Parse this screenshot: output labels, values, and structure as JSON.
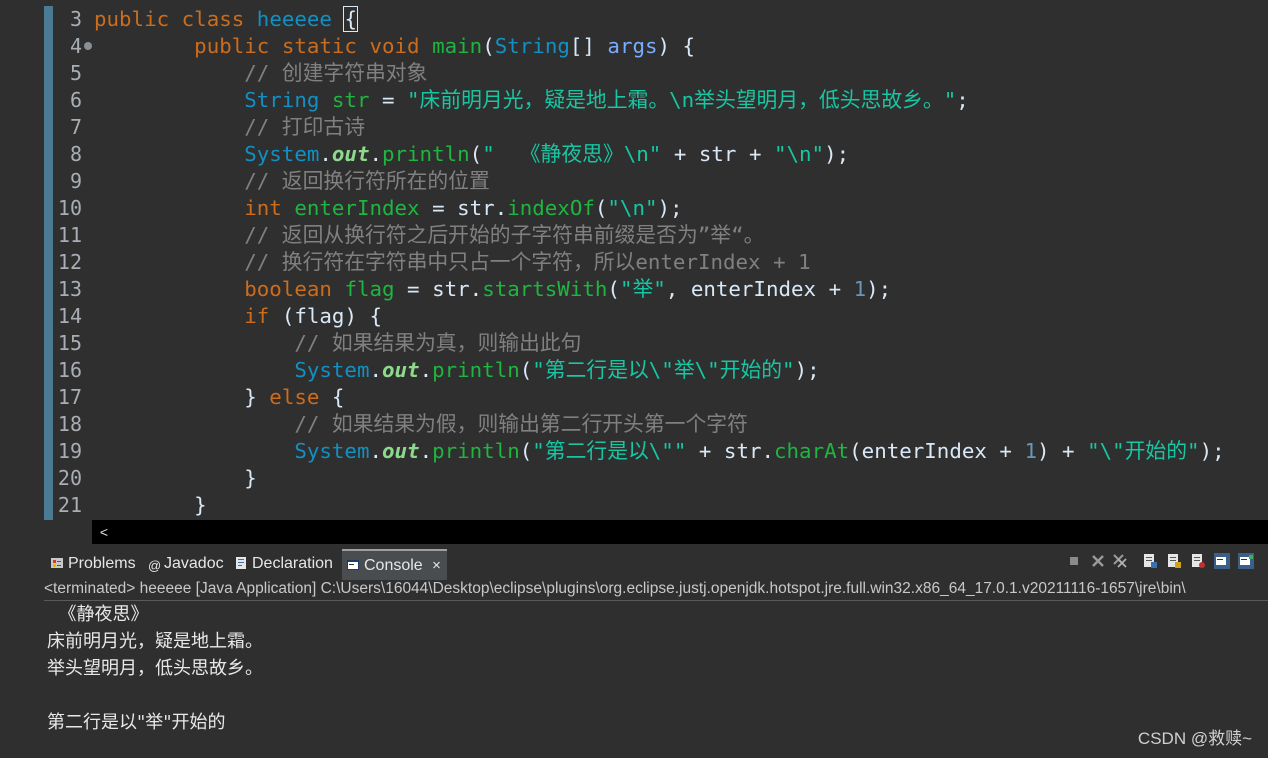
{
  "editor": {
    "line_numbers": [
      "3",
      "4",
      "5",
      "6",
      "7",
      "8",
      "9",
      "10",
      "11",
      "12",
      "13",
      "14",
      "15",
      "16",
      "17",
      "18",
      "19",
      "20",
      "21"
    ],
    "lines": [
      [
        [
          "kw",
          "public"
        ],
        [
          "pl",
          " "
        ],
        [
          "kw",
          "class"
        ],
        [
          "pl",
          " "
        ],
        [
          "ty",
          "heeeee"
        ],
        [
          "pl",
          " "
        ],
        [
          "brace",
          "{"
        ]
      ],
      [
        [
          "pl",
          "        "
        ],
        [
          "kw",
          "public"
        ],
        [
          "pl",
          " "
        ],
        [
          "kw",
          "static"
        ],
        [
          "pl",
          " "
        ],
        [
          "kw",
          "void"
        ],
        [
          "pl",
          " "
        ],
        [
          "df",
          "main"
        ],
        [
          "pl",
          "("
        ],
        [
          "ty",
          "String"
        ],
        [
          "pl",
          "[] "
        ],
        [
          "pm",
          "args"
        ],
        [
          "pl",
          ") {"
        ]
      ],
      [
        [
          "pl",
          "            "
        ],
        [
          "cm",
          "// 创建字符串对象"
        ]
      ],
      [
        [
          "pl",
          "            "
        ],
        [
          "ty",
          "String"
        ],
        [
          "pl",
          " "
        ],
        [
          "df",
          "str"
        ],
        [
          "pl",
          " = "
        ],
        [
          "st",
          "\"床前明月光，疑是地上霜。\\n举头望明月，低头思故乡。\""
        ],
        [
          "pl",
          ";"
        ]
      ],
      [
        [
          "pl",
          "            "
        ],
        [
          "cm",
          "// 打印古诗"
        ]
      ],
      [
        [
          "pl",
          "            "
        ],
        [
          "ty",
          "System"
        ],
        [
          "pl",
          "."
        ],
        [
          "fd",
          "out"
        ],
        [
          "pl",
          "."
        ],
        [
          "fn",
          "println"
        ],
        [
          "pl",
          "("
        ],
        [
          "st",
          "\"  《静夜思》\\n\""
        ],
        [
          "pl",
          " + "
        ],
        [
          "pl",
          "str"
        ],
        [
          "pl",
          " + "
        ],
        [
          "st",
          "\"\\n\""
        ],
        [
          "pl",
          ");"
        ]
      ],
      [
        [
          "pl",
          "            "
        ],
        [
          "cm",
          "// 返回换行符所在的位置"
        ]
      ],
      [
        [
          "pl",
          "            "
        ],
        [
          "kw",
          "int"
        ],
        [
          "pl",
          " "
        ],
        [
          "df",
          "enterIndex"
        ],
        [
          "pl",
          " = "
        ],
        [
          "pl",
          "str"
        ],
        [
          "pl",
          "."
        ],
        [
          "fn",
          "indexOf"
        ],
        [
          "pl",
          "("
        ],
        [
          "st",
          "\"\\n\""
        ],
        [
          "pl",
          ");"
        ]
      ],
      [
        [
          "pl",
          "            "
        ],
        [
          "cm",
          "// 返回从换行符之后开始的子字符串前缀是否为”举“。"
        ]
      ],
      [
        [
          "pl",
          "            "
        ],
        [
          "cm",
          "// 换行符在字符串中只占一个字符，所以enterIndex + 1"
        ]
      ],
      [
        [
          "pl",
          "            "
        ],
        [
          "kw",
          "boolean"
        ],
        [
          "pl",
          " "
        ],
        [
          "df",
          "flag"
        ],
        [
          "pl",
          " = "
        ],
        [
          "pl",
          "str"
        ],
        [
          "pl",
          "."
        ],
        [
          "fn",
          "startsWith"
        ],
        [
          "pl",
          "("
        ],
        [
          "st",
          "\"举\""
        ],
        [
          "pl",
          ", "
        ],
        [
          "pl",
          "enterIndex"
        ],
        [
          "pl",
          " + "
        ],
        [
          "nm",
          "1"
        ],
        [
          "pl",
          ");"
        ]
      ],
      [
        [
          "pl",
          "            "
        ],
        [
          "kw",
          "if"
        ],
        [
          "pl",
          " ("
        ],
        [
          "pl",
          "flag"
        ],
        [
          "pl",
          ") {"
        ]
      ],
      [
        [
          "pl",
          "                "
        ],
        [
          "cm",
          "// 如果结果为真，则输出此句"
        ]
      ],
      [
        [
          "pl",
          "                "
        ],
        [
          "ty",
          "System"
        ],
        [
          "pl",
          "."
        ],
        [
          "fd",
          "out"
        ],
        [
          "pl",
          "."
        ],
        [
          "fn",
          "println"
        ],
        [
          "pl",
          "("
        ],
        [
          "st",
          "\"第二行是以\\\"举\\\"开始的\""
        ],
        [
          "pl",
          ");"
        ]
      ],
      [
        [
          "pl",
          "            "
        ],
        [
          "pl",
          "} "
        ],
        [
          "kw",
          "else"
        ],
        [
          "pl",
          " {"
        ]
      ],
      [
        [
          "pl",
          "                "
        ],
        [
          "cm",
          "// 如果结果为假，则输出第二行开头第一个字符"
        ]
      ],
      [
        [
          "pl",
          "                "
        ],
        [
          "ty",
          "System"
        ],
        [
          "pl",
          "."
        ],
        [
          "fd",
          "out"
        ],
        [
          "pl",
          "."
        ],
        [
          "fn",
          "println"
        ],
        [
          "pl",
          "("
        ],
        [
          "st",
          "\"第二行是以\\\"\""
        ],
        [
          "pl",
          " + "
        ],
        [
          "pl",
          "str"
        ],
        [
          "pl",
          "."
        ],
        [
          "fn",
          "charAt"
        ],
        [
          "pl",
          "("
        ],
        [
          "pl",
          "enterIndex"
        ],
        [
          "pl",
          " + "
        ],
        [
          "nm",
          "1"
        ],
        [
          "pl",
          ") + "
        ],
        [
          "st",
          "\"\\\"开始的\""
        ],
        [
          "pl",
          ");"
        ]
      ],
      [
        [
          "pl",
          "            "
        ],
        [
          "pl",
          "}"
        ]
      ],
      [
        [
          "pl",
          "        "
        ],
        [
          "pl",
          "}"
        ]
      ]
    ]
  },
  "scrollbar": {
    "left_arrow": "<"
  },
  "tabs": {
    "problems": "Problems",
    "javadoc": "Javadoc",
    "declaration": "Declaration",
    "console": "Console",
    "close": "×"
  },
  "console": {
    "header": "<terminated> heeeee [Java Application] C:\\Users\\16044\\Desktop\\eclipse\\plugins\\org.eclipse.justj.openjdk.hotspot.jre.full.win32.x86_64_17.0.1.v20211116-1657\\jre\\bin\\",
    "output": [
      "  《静夜思》",
      "床前明月光，疑是地上霜。",
      "举头望明月，低头思故乡。",
      "",
      "第二行是以\"举\"开始的"
    ]
  },
  "watermark": "CSDN @救赎~",
  "icons": {
    "problems": "problems-icon",
    "javadoc": "javadoc-icon",
    "declaration": "declaration-icon",
    "console": "console-icon",
    "terminate": "terminate-icon",
    "remove_launch": "remove-launch-icon",
    "remove_all": "remove-all-icon",
    "scroll_lock": "scroll-lock-icon",
    "word_wrap": "word-wrap-icon",
    "pin": "pin-icon",
    "display_console": "display-console-icon",
    "open_console": "open-console-icon"
  },
  "colors": {
    "keyword": "#cc6c1d",
    "type": "#1290c3",
    "string": "#17c6a3",
    "comment": "#808080",
    "method": "#1eb540",
    "background": "#2f2f2f"
  }
}
